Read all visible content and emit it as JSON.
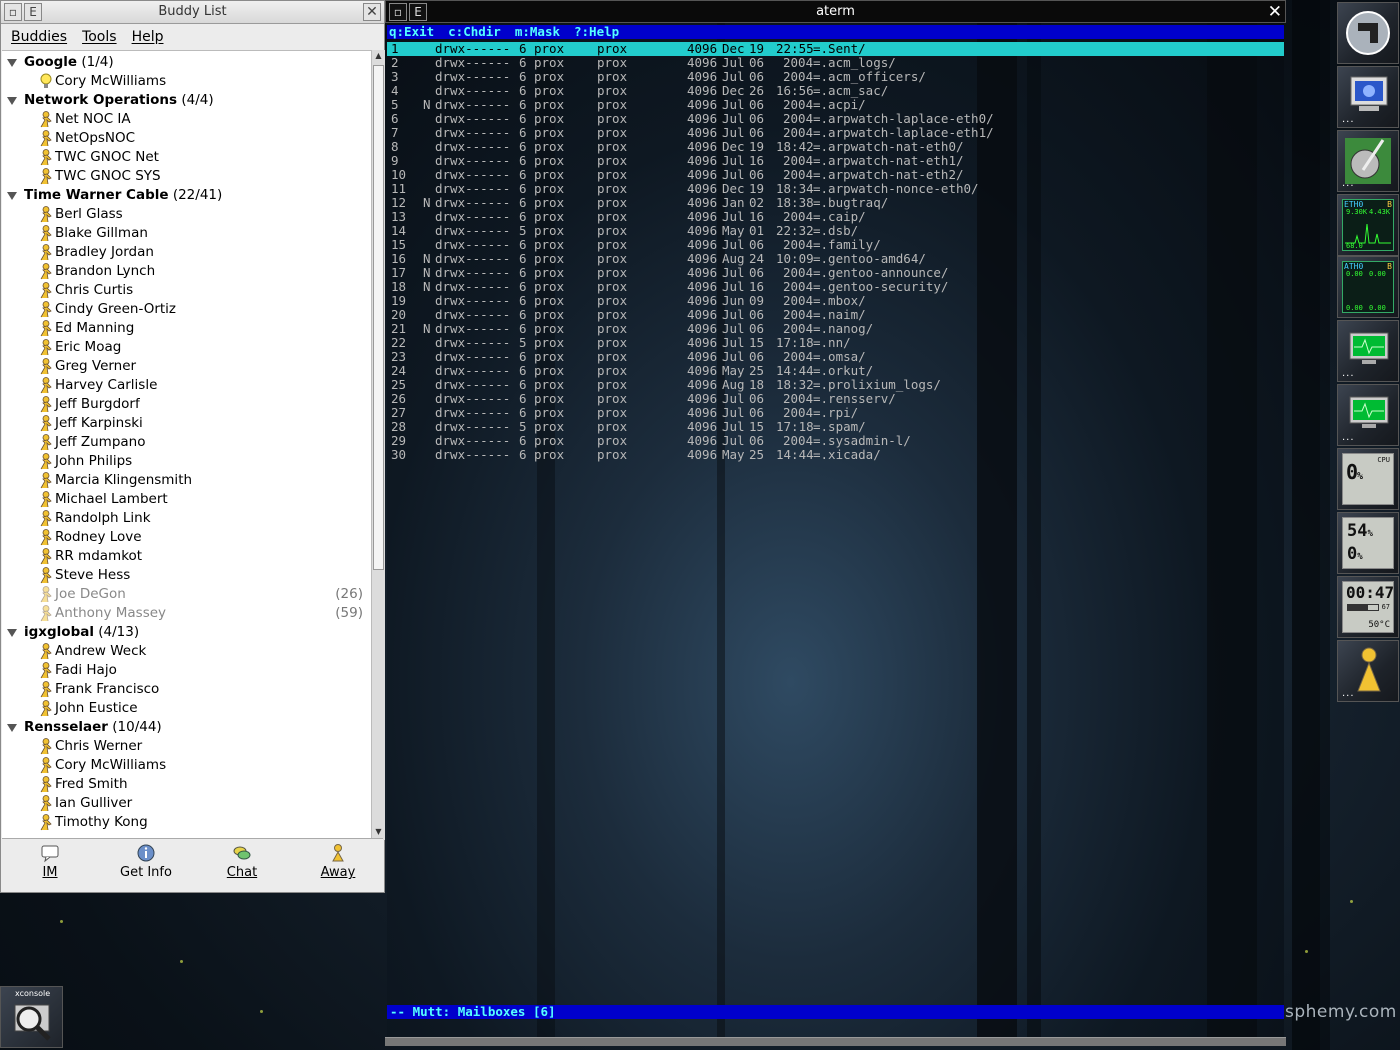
{
  "buddy_window": {
    "title": "Buddy List",
    "menu": [
      "Buddies",
      "Tools",
      "Help"
    ],
    "groups": [
      {
        "name": "Google",
        "count": "(1/4)",
        "buddies": [
          {
            "name": "Cory McWilliams",
            "icon": "lightbulb-icon"
          }
        ]
      },
      {
        "name": "Network Operations",
        "count": "(4/4)",
        "buddies": [
          {
            "name": "Net NOC IA"
          },
          {
            "name": "NetOpsNOC"
          },
          {
            "name": "TWC GNOC Net"
          },
          {
            "name": "TWC GNOC SYS"
          }
        ]
      },
      {
        "name": "Time Warner Cable",
        "count": "(22/41)",
        "buddies": [
          {
            "name": "Berl Glass"
          },
          {
            "name": "Blake Gillman"
          },
          {
            "name": "Bradley Jordan"
          },
          {
            "name": "Brandon Lynch"
          },
          {
            "name": "Chris Curtis"
          },
          {
            "name": "Cindy Green-Ortiz"
          },
          {
            "name": "Ed Manning"
          },
          {
            "name": "Eric Moag"
          },
          {
            "name": "Greg Verner"
          },
          {
            "name": "Harvey Carlisle"
          },
          {
            "name": "Jeff Burgdorf"
          },
          {
            "name": "Jeff Karpinski"
          },
          {
            "name": "Jeff Zumpano"
          },
          {
            "name": "John Philips"
          },
          {
            "name": "Marcia Klingensmith"
          },
          {
            "name": "Michael Lambert"
          },
          {
            "name": "Randolph Link"
          },
          {
            "name": "Rodney Love"
          },
          {
            "name": "RR mdamkot"
          },
          {
            "name": "Steve Hess"
          },
          {
            "name": "Joe DeGon",
            "idle": "(26)"
          },
          {
            "name": "Anthony Massey",
            "idle": "(59)"
          }
        ]
      },
      {
        "name": "igxglobal",
        "count": "(4/13)",
        "buddies": [
          {
            "name": "Andrew Weck"
          },
          {
            "name": "Fadi Hajo"
          },
          {
            "name": "Frank Francisco"
          },
          {
            "name": "John Eustice"
          }
        ]
      },
      {
        "name": "Rensselaer",
        "count": "(10/44)",
        "buddies": [
          {
            "name": "Chris Werner"
          },
          {
            "name": "Cory McWilliams"
          },
          {
            "name": "Fred Smith"
          },
          {
            "name": "Ian Gulliver"
          },
          {
            "name": "Timothy Kong"
          }
        ]
      }
    ],
    "toolbar": {
      "im": "IM",
      "get_info": "Get Info",
      "chat": "Chat",
      "away": "Away"
    }
  },
  "terminal": {
    "title": "aterm",
    "help": [
      "q:Exit",
      "c:Chdir",
      "m:Mask",
      "?:Help"
    ],
    "rows": [
      {
        "n": "1",
        "flag": "",
        "perm": "drwx------",
        "links": "6",
        "user": "prox",
        "group": "prox",
        "size": "4096",
        "month": "Dec",
        "day": "19",
        "time": "22:55",
        "name": "=.Sent/"
      },
      {
        "n": "2",
        "flag": "",
        "perm": "drwx------",
        "links": "6",
        "user": "prox",
        "group": "prox",
        "size": "4096",
        "month": "Jul",
        "day": "06",
        "time": "2004",
        "name": "=.acm_logs/"
      },
      {
        "n": "3",
        "flag": "",
        "perm": "drwx------",
        "links": "6",
        "user": "prox",
        "group": "prox",
        "size": "4096",
        "month": "Jul",
        "day": "06",
        "time": "2004",
        "name": "=.acm_officers/"
      },
      {
        "n": "4",
        "flag": "",
        "perm": "drwx------",
        "links": "6",
        "user": "prox",
        "group": "prox",
        "size": "4096",
        "month": "Dec",
        "day": "26",
        "time": "16:56",
        "name": "=.acm_sac/"
      },
      {
        "n": "5",
        "flag": "N",
        "perm": "drwx------",
        "links": "6",
        "user": "prox",
        "group": "prox",
        "size": "4096",
        "month": "Jul",
        "day": "06",
        "time": "2004",
        "name": "=.acpi/"
      },
      {
        "n": "6",
        "flag": "",
        "perm": "drwx------",
        "links": "6",
        "user": "prox",
        "group": "prox",
        "size": "4096",
        "month": "Jul",
        "day": "06",
        "time": "2004",
        "name": "=.arpwatch-laplace-eth0/"
      },
      {
        "n": "7",
        "flag": "",
        "perm": "drwx------",
        "links": "6",
        "user": "prox",
        "group": "prox",
        "size": "4096",
        "month": "Jul",
        "day": "06",
        "time": "2004",
        "name": "=.arpwatch-laplace-eth1/"
      },
      {
        "n": "8",
        "flag": "",
        "perm": "drwx------",
        "links": "6",
        "user": "prox",
        "group": "prox",
        "size": "4096",
        "month": "Dec",
        "day": "19",
        "time": "18:42",
        "name": "=.arpwatch-nat-eth0/"
      },
      {
        "n": "9",
        "flag": "",
        "perm": "drwx------",
        "links": "6",
        "user": "prox",
        "group": "prox",
        "size": "4096",
        "month": "Jul",
        "day": "16",
        "time": "2004",
        "name": "=.arpwatch-nat-eth1/"
      },
      {
        "n": "10",
        "flag": "",
        "perm": "drwx------",
        "links": "6",
        "user": "prox",
        "group": "prox",
        "size": "4096",
        "month": "Jul",
        "day": "06",
        "time": "2004",
        "name": "=.arpwatch-nat-eth2/"
      },
      {
        "n": "11",
        "flag": "",
        "perm": "drwx------",
        "links": "6",
        "user": "prox",
        "group": "prox",
        "size": "4096",
        "month": "Dec",
        "day": "19",
        "time": "18:34",
        "name": "=.arpwatch-nonce-eth0/"
      },
      {
        "n": "12",
        "flag": "N",
        "perm": "drwx------",
        "links": "6",
        "user": "prox",
        "group": "prox",
        "size": "4096",
        "month": "Jan",
        "day": "02",
        "time": "18:38",
        "name": "=.bugtraq/"
      },
      {
        "n": "13",
        "flag": "",
        "perm": "drwx------",
        "links": "6",
        "user": "prox",
        "group": "prox",
        "size": "4096",
        "month": "Jul",
        "day": "16",
        "time": "2004",
        "name": "=.caip/"
      },
      {
        "n": "14",
        "flag": "",
        "perm": "drwx------",
        "links": "5",
        "user": "prox",
        "group": "prox",
        "size": "4096",
        "month": "May",
        "day": "01",
        "time": "22:32",
        "name": "=.dsb/"
      },
      {
        "n": "15",
        "flag": "",
        "perm": "drwx------",
        "links": "6",
        "user": "prox",
        "group": "prox",
        "size": "4096",
        "month": "Jul",
        "day": "06",
        "time": "2004",
        "name": "=.family/"
      },
      {
        "n": "16",
        "flag": "N",
        "perm": "drwx------",
        "links": "6",
        "user": "prox",
        "group": "prox",
        "size": "4096",
        "month": "Aug",
        "day": "24",
        "time": "10:09",
        "name": "=.gentoo-amd64/"
      },
      {
        "n": "17",
        "flag": "N",
        "perm": "drwx------",
        "links": "6",
        "user": "prox",
        "group": "prox",
        "size": "4096",
        "month": "Jul",
        "day": "06",
        "time": "2004",
        "name": "=.gentoo-announce/"
      },
      {
        "n": "18",
        "flag": "N",
        "perm": "drwx------",
        "links": "6",
        "user": "prox",
        "group": "prox",
        "size": "4096",
        "month": "Jul",
        "day": "16",
        "time": "2004",
        "name": "=.gentoo-security/"
      },
      {
        "n": "19",
        "flag": "",
        "perm": "drwx------",
        "links": "6",
        "user": "prox",
        "group": "prox",
        "size": "4096",
        "month": "Jun",
        "day": "09",
        "time": "2004",
        "name": "=.mbox/"
      },
      {
        "n": "20",
        "flag": "",
        "perm": "drwx------",
        "links": "6",
        "user": "prox",
        "group": "prox",
        "size": "4096",
        "month": "Jul",
        "day": "06",
        "time": "2004",
        "name": "=.naim/"
      },
      {
        "n": "21",
        "flag": "N",
        "perm": "drwx------",
        "links": "6",
        "user": "prox",
        "group": "prox",
        "size": "4096",
        "month": "Jul",
        "day": "06",
        "time": "2004",
        "name": "=.nanog/"
      },
      {
        "n": "22",
        "flag": "",
        "perm": "drwx------",
        "links": "5",
        "user": "prox",
        "group": "prox",
        "size": "4096",
        "month": "Jul",
        "day": "15",
        "time": "17:18",
        "name": "=.nn/"
      },
      {
        "n": "23",
        "flag": "",
        "perm": "drwx------",
        "links": "6",
        "user": "prox",
        "group": "prox",
        "size": "4096",
        "month": "Jul",
        "day": "06",
        "time": "2004",
        "name": "=.omsa/"
      },
      {
        "n": "24",
        "flag": "",
        "perm": "drwx------",
        "links": "6",
        "user": "prox",
        "group": "prox",
        "size": "4096",
        "month": "May",
        "day": "25",
        "time": "14:44",
        "name": "=.orkut/"
      },
      {
        "n": "25",
        "flag": "",
        "perm": "drwx------",
        "links": "6",
        "user": "prox",
        "group": "prox",
        "size": "4096",
        "month": "Aug",
        "day": "18",
        "time": "18:32",
        "name": "=.prolixium_logs/"
      },
      {
        "n": "26",
        "flag": "",
        "perm": "drwx------",
        "links": "6",
        "user": "prox",
        "group": "prox",
        "size": "4096",
        "month": "Jul",
        "day": "06",
        "time": "2004",
        "name": "=.rensserv/"
      },
      {
        "n": "27",
        "flag": "",
        "perm": "drwx------",
        "links": "6",
        "user": "prox",
        "group": "prox",
        "size": "4096",
        "month": "Jul",
        "day": "06",
        "time": "2004",
        "name": "=.rpi/"
      },
      {
        "n": "28",
        "flag": "",
        "perm": "drwx------",
        "links": "5",
        "user": "prox",
        "group": "prox",
        "size": "4096",
        "month": "Jul",
        "day": "15",
        "time": "17:18",
        "name": "=.spam/"
      },
      {
        "n": "29",
        "flag": "",
        "perm": "drwx------",
        "links": "6",
        "user": "prox",
        "group": "prox",
        "size": "4096",
        "month": "Jul",
        "day": "06",
        "time": "2004",
        "name": "=.sysadmin-l/"
      },
      {
        "n": "30",
        "flag": "",
        "perm": "drwx------",
        "links": "6",
        "user": "prox",
        "group": "prox",
        "size": "4096",
        "month": "May",
        "day": "25",
        "time": "14:44",
        "name": "=.xicada/"
      }
    ],
    "status": "-- Mutt: Mailboxes [6]"
  },
  "dock": {
    "net1": {
      "iface": "ETH0",
      "rx": "9.30K",
      "tx": "4.43K",
      "b": "B",
      "bottom": "68.0"
    },
    "net2": {
      "iface": "ATH0",
      "rx": "0.00",
      "tx": "0.00",
      "b": "B",
      "bottom_a": "0.00",
      "bottom_b": "0.00"
    },
    "cpu": {
      "value": "0",
      "unit": "%",
      "label": "CPU"
    },
    "mem": {
      "v1": "54",
      "v2": "0",
      "unit": "%"
    },
    "clock": {
      "time": "00:47",
      "battery": "67",
      "temp": "50°C"
    }
  },
  "xconsole": {
    "label": "xconsole"
  },
  "watermark": "sphemy.com",
  "colors": {
    "term_help_bg": "#0000cc",
    "term_help_fg": "#55ffff",
    "selection": "#22cccc"
  }
}
